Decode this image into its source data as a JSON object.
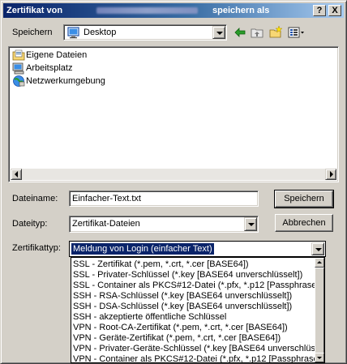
{
  "window": {
    "title_prefix": "Zertifikat von",
    "title_suffix": "speichern als",
    "help_glyph": "?",
    "close_glyph": "X"
  },
  "location": {
    "label": "Speichern",
    "value": "Desktop",
    "icon": "desktop-icon"
  },
  "toolbar": {
    "back_icon": "back-arrow-icon",
    "up_icon": "up-folder-icon",
    "new_folder_icon": "new-folder-icon",
    "view_icon": "view-menu-icon"
  },
  "files": [
    {
      "label": "Eigene Dateien",
      "icon": "my-documents-icon"
    },
    {
      "label": "Arbeitsplatz",
      "icon": "my-computer-icon"
    },
    {
      "label": "Netzwerkumgebung",
      "icon": "network-icon"
    }
  ],
  "filename": {
    "label": "Dateiname:",
    "value": "Einfacher-Text.txt"
  },
  "filetype": {
    "label": "Dateityp:",
    "value": "Zertifikat-Dateien"
  },
  "certtype": {
    "label": "Zertifikattyp:",
    "value": "Meldung von Login (einfacher Text)"
  },
  "buttons": {
    "save": "Speichern",
    "cancel": "Abbrechen"
  },
  "certtype_options": [
    "SSL - Zertifikat (*.pem, *.crt, *.cer [BASE64])",
    "SSL - Privater-Schlüssel (*.key [BASE64 unverschlüsselt])",
    "SSL - Container als PKCS#12-Datei (*.pfx, *.p12 [Passphrase e",
    "SSH - RSA-Schlüssel (*.key [BASE64 unverschlüsselt])",
    "SSH - DSA-Schlüssel (*.key [BASE64 unverschlüsselt])",
    "SSH - akzeptierte öffentliche Schlüssel",
    "VPN - Root-CA-Zertifikat (*.pem, *.crt, *.cer [BASE64])",
    "VPN - Geräte-Zertifikat (*.pem, *.crt, *.cer [BASE64])",
    "VPN - Privater-Geräte-Schlüssel (*.key [BASE64 unverschlüs",
    "VPN - Container als PKCS#12-Datei (*.pfx, *.p12 [Passphrase e"
  ],
  "colors": {
    "title_gradient_start": "#0a246a",
    "title_gradient_end": "#a6caf0",
    "selection": "#0a246a",
    "face": "#d4d0c8"
  }
}
